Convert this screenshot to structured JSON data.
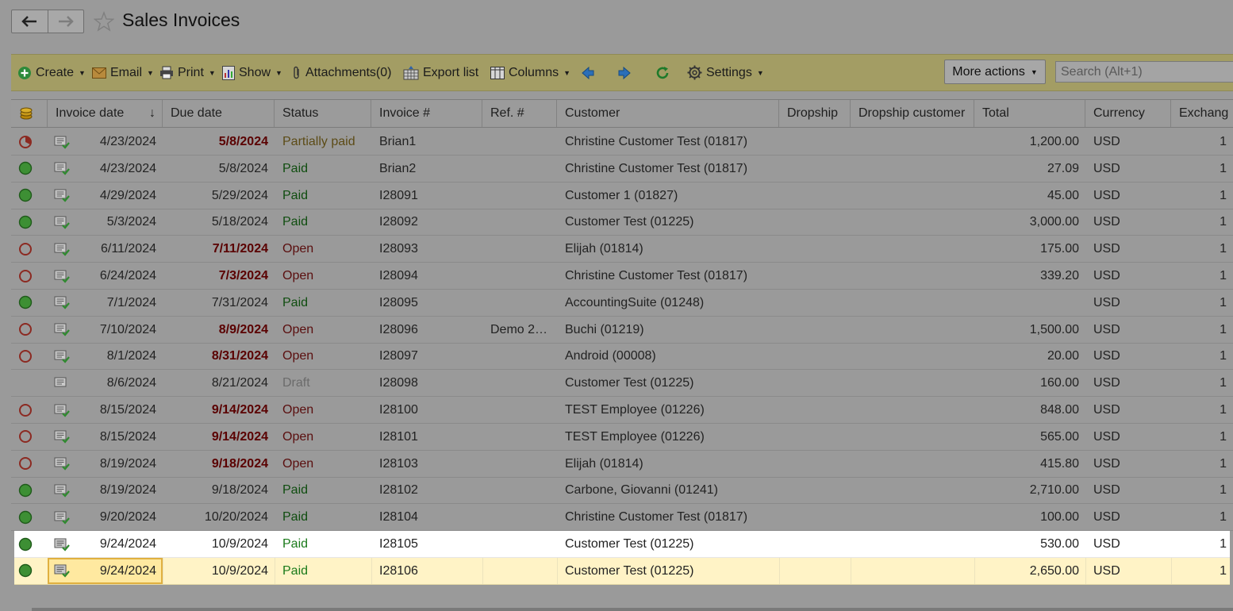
{
  "window": {
    "title": "Sales Invoices"
  },
  "toolbar": {
    "create": "Create",
    "email": "Email",
    "print": "Print",
    "show": "Show",
    "attachments": "Attachments(0)",
    "export_list": "Export list",
    "columns": "Columns",
    "settings": "Settings",
    "more_actions": "More actions",
    "search_placeholder": "Search (Alt+1)"
  },
  "columns": [
    "Invoice date",
    "Due date",
    "Status",
    "Invoice #",
    "Ref. #",
    "Customer",
    "Dropship",
    "Dropship customer",
    "Total",
    "Currency",
    "Exchang"
  ],
  "sort_indicator": "↓",
  "rows": [
    {
      "icon": "partial-circle",
      "date": "4/23/2024",
      "due": "5/8/2024",
      "overdue": true,
      "status": "Partially paid",
      "status_type": "partial",
      "num": "Brian1",
      "ref": "",
      "customer": "Christine Customer Test (01817)",
      "total": "1,200.00",
      "currency": "USD",
      "exch": "1"
    },
    {
      "icon": "green-circle",
      "date": "4/23/2024",
      "due": "5/8/2024",
      "overdue": false,
      "status": "Paid",
      "status_type": "paid",
      "num": "Brian2",
      "ref": "",
      "customer": "Christine Customer Test (01817)",
      "total": "27.09",
      "currency": "USD",
      "exch": "1"
    },
    {
      "icon": "green-circle",
      "date": "4/29/2024",
      "due": "5/29/2024",
      "overdue": false,
      "status": "Paid",
      "status_type": "paid",
      "num": "I28091",
      "ref": "",
      "customer": "Customer 1 (01827)",
      "total": "45.00",
      "currency": "USD",
      "exch": "1"
    },
    {
      "icon": "green-circle",
      "date": "5/3/2024",
      "due": "5/18/2024",
      "overdue": false,
      "status": "Paid",
      "status_type": "paid",
      "num": "I28092",
      "ref": "",
      "customer": "Customer Test (01225)",
      "total": "3,000.00",
      "currency": "USD",
      "exch": "1"
    },
    {
      "icon": "open-circle",
      "date": "6/11/2024",
      "due": "7/11/2024",
      "overdue": true,
      "status": "Open",
      "status_type": "open",
      "num": "I28093",
      "ref": "",
      "customer": "Elijah (01814)",
      "total": "175.00",
      "currency": "USD",
      "exch": "1"
    },
    {
      "icon": "open-circle",
      "date": "6/24/2024",
      "due": "7/3/2024",
      "overdue": true,
      "status": "Open",
      "status_type": "open",
      "num": "I28094",
      "ref": "",
      "customer": "Christine Customer Test (01817)",
      "total": "339.20",
      "currency": "USD",
      "exch": "1"
    },
    {
      "icon": "green-circle",
      "date": "7/1/2024",
      "due": "7/31/2024",
      "overdue": false,
      "status": "Paid",
      "status_type": "paid",
      "num": "I28095",
      "ref": "",
      "customer": "AccountingSuite (01248)",
      "total": "",
      "currency": "USD",
      "exch": "1"
    },
    {
      "icon": "open-circle",
      "date": "7/10/2024",
      "due": "8/9/2024",
      "overdue": true,
      "status": "Open",
      "status_type": "open",
      "num": "I28096",
      "ref": "Demo 2…",
      "customer": "Buchi (01219)",
      "total": "1,500.00",
      "currency": "USD",
      "exch": "1"
    },
    {
      "icon": "open-circle",
      "date": "8/1/2024",
      "due": "8/31/2024",
      "overdue": true,
      "status": "Open",
      "status_type": "open",
      "num": "I28097",
      "ref": "",
      "customer": "Android (00008)",
      "total": "20.00",
      "currency": "USD",
      "exch": "1"
    },
    {
      "icon": "none",
      "date": "8/6/2024",
      "due": "8/21/2024",
      "overdue": false,
      "status": "Draft",
      "status_type": "draft",
      "num": "I28098",
      "ref": "",
      "customer": "Customer Test (01225)",
      "total": "160.00",
      "currency": "USD",
      "exch": "1"
    },
    {
      "icon": "open-circle",
      "date": "8/15/2024",
      "due": "9/14/2024",
      "overdue": true,
      "status": "Open",
      "status_type": "open",
      "num": "I28100",
      "ref": "",
      "customer": "TEST Employee (01226)",
      "total": "848.00",
      "currency": "USD",
      "exch": "1"
    },
    {
      "icon": "open-circle",
      "date": "8/15/2024",
      "due": "9/14/2024",
      "overdue": true,
      "status": "Open",
      "status_type": "open",
      "num": "I28101",
      "ref": "",
      "customer": "TEST Employee (01226)",
      "total": "565.00",
      "currency": "USD",
      "exch": "1"
    },
    {
      "icon": "open-circle",
      "date": "8/19/2024",
      "due": "9/18/2024",
      "overdue": true,
      "status": "Open",
      "status_type": "open",
      "num": "I28103",
      "ref": "",
      "customer": "Elijah (01814)",
      "total": "415.80",
      "currency": "USD",
      "exch": "1"
    },
    {
      "icon": "green-circle",
      "date": "8/19/2024",
      "due": "9/18/2024",
      "overdue": false,
      "status": "Paid",
      "status_type": "paid",
      "num": "I28102",
      "ref": "",
      "customer": "Carbone, Giovanni (01241)",
      "total": "2,710.00",
      "currency": "USD",
      "exch": "1"
    },
    {
      "icon": "green-circle",
      "date": "9/20/2024",
      "due": "10/20/2024",
      "overdue": false,
      "status": "Paid",
      "status_type": "paid",
      "num": "I28104",
      "ref": "",
      "customer": "Christine Customer Test (01817)",
      "total": "100.00",
      "currency": "USD",
      "exch": "1"
    },
    {
      "icon": "green-circle",
      "date": "9/24/2024",
      "due": "10/9/2024",
      "overdue": false,
      "status": "Paid",
      "status_type": "paid",
      "num": "I28105",
      "ref": "",
      "customer": "Customer Test (01225)",
      "total": "530.00",
      "currency": "USD",
      "exch": "1",
      "highlight": "white"
    },
    {
      "icon": "green-circle",
      "date": "9/24/2024",
      "due": "10/9/2024",
      "overdue": false,
      "status": "Paid",
      "status_type": "paid",
      "num": "I28106",
      "ref": "",
      "customer": "Customer Test (01225)",
      "total": "2,650.00",
      "currency": "USD",
      "exch": "1",
      "highlight": "yellow",
      "selected": true
    }
  ],
  "colors": {
    "paid_green": "#3aa13a",
    "open_red": "#c0392b",
    "toolbar_bg": "#a39d64",
    "selected_row": "#fff3c6"
  }
}
